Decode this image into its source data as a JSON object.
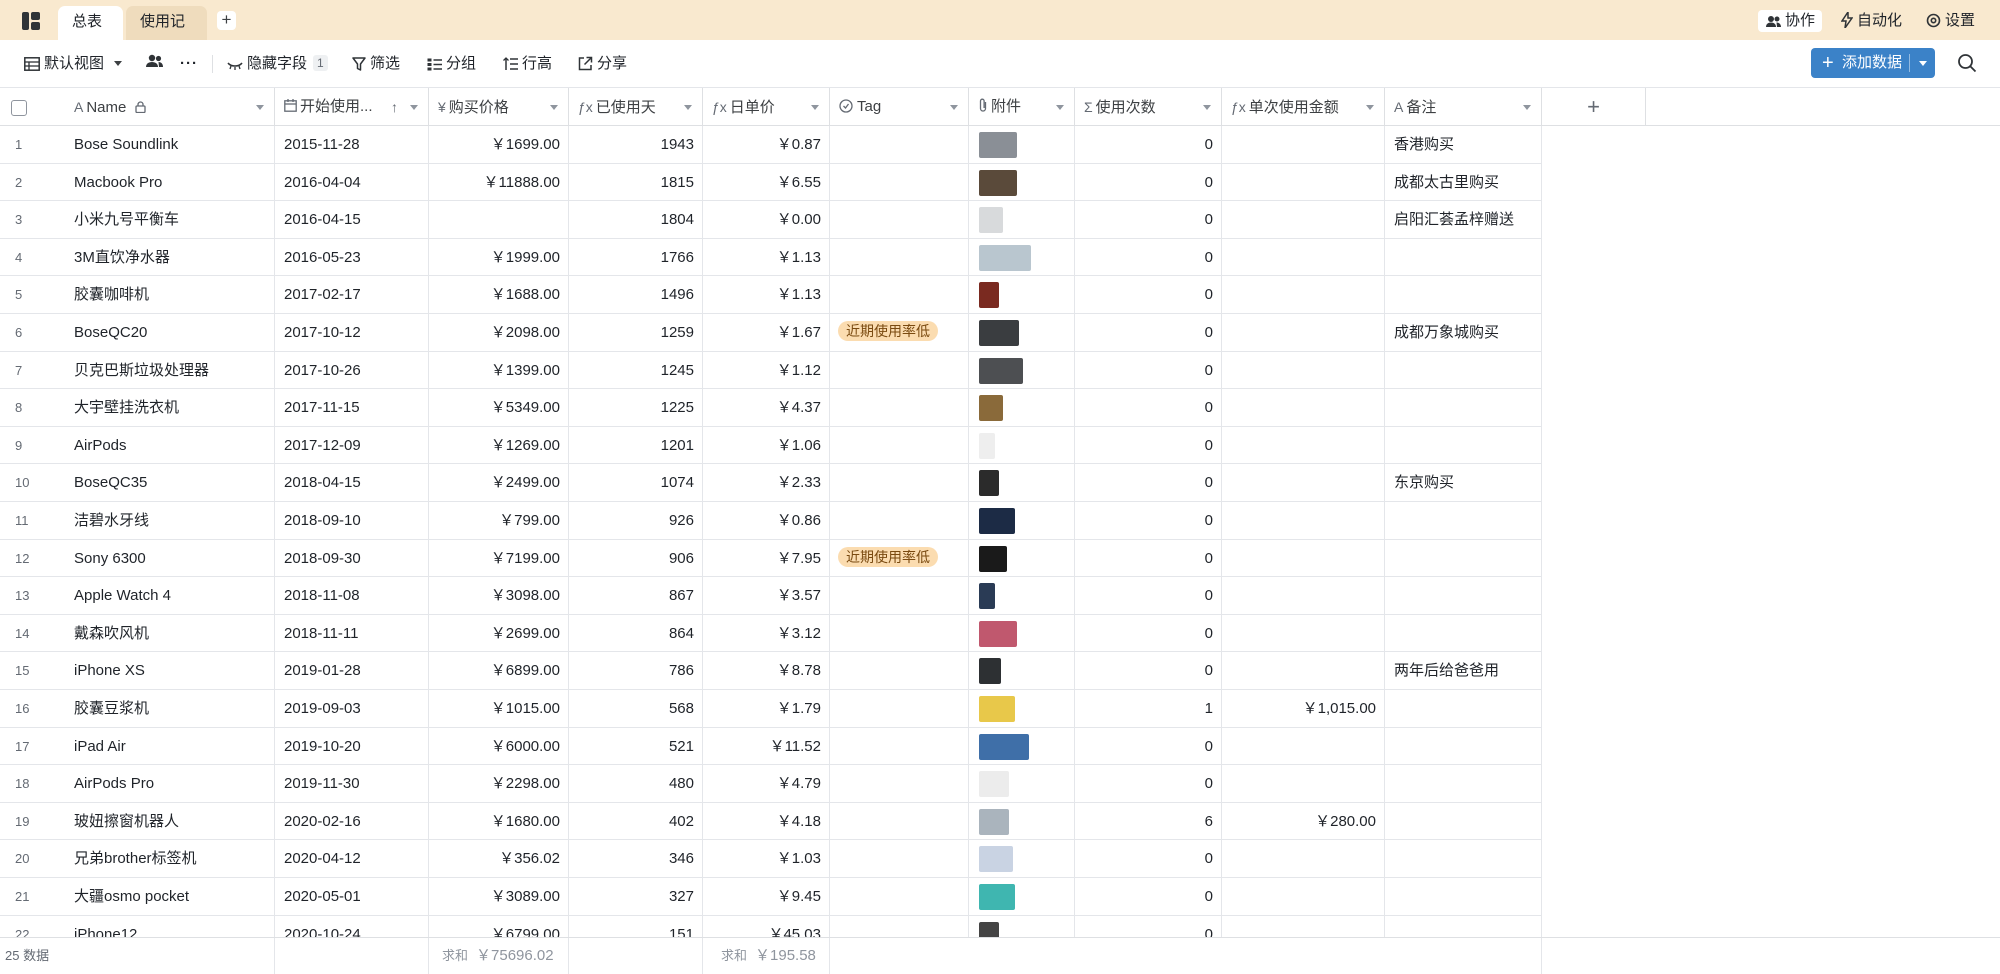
{
  "topbar": {
    "tabs": [
      {
        "label": "总表",
        "active": true
      },
      {
        "label": "使用记录",
        "active": false
      }
    ],
    "add_tab": "+",
    "collab": "协作",
    "automation": "自动化",
    "settings": "设置"
  },
  "toolbar": {
    "view": "默认视图",
    "more": "···",
    "hide_fields": "隐藏字段",
    "hide_fields_count": "1",
    "filter": "筛选",
    "group": "分组",
    "row_height": "行高",
    "share": "分享",
    "add_record": "添加数据"
  },
  "columns": [
    {
      "key": "name",
      "label": "Name",
      "type_icon": "A",
      "lock": true
    },
    {
      "key": "start",
      "label": "开始使用...",
      "type_icon": "date-icon",
      "sort": "↑"
    },
    {
      "key": "price",
      "label": "购买价格",
      "type_icon": "¥"
    },
    {
      "key": "days",
      "label": "已使用天",
      "type_icon": "ƒx"
    },
    {
      "key": "daily",
      "label": "日单价",
      "type_icon": "ƒx"
    },
    {
      "key": "tag",
      "label": "Tag",
      "type_icon": "single-select-icon"
    },
    {
      "key": "attachment",
      "label": "附件",
      "type_icon": "paperclip-icon"
    },
    {
      "key": "uses",
      "label": "使用次数",
      "type_icon": "Σ"
    },
    {
      "key": "per_use",
      "label": "单次使用金额",
      "type_icon": "ƒx"
    },
    {
      "key": "note",
      "label": "备注",
      "type_icon": "A"
    }
  ],
  "add_column": "+",
  "rows": [
    {
      "idx": "1",
      "name": "Bose Soundlink",
      "start": "2015-11-28",
      "price": "￥1699.00",
      "days": "1943",
      "daily": "￥0.87",
      "tag": "",
      "thumb_color": "#8a8f96",
      "uses": "0",
      "per_use": "",
      "note": "香港购买"
    },
    {
      "idx": "2",
      "name": "Macbook Pro",
      "start": "2016-04-04",
      "price": "￥11888.00",
      "days": "1815",
      "daily": "￥6.55",
      "tag": "",
      "thumb_color": "#5a4a3a",
      "uses": "0",
      "per_use": "",
      "note": "成都太古里购买"
    },
    {
      "idx": "3",
      "name": "小米九号平衡车",
      "start": "2016-04-15",
      "price": "",
      "days": "1804",
      "daily": "￥0.00",
      "tag": "",
      "thumb_color": "#d8dadc",
      "uses": "0",
      "per_use": "",
      "note": "启阳汇荟孟梓赠送"
    },
    {
      "idx": "4",
      "name": "3M直饮净水器",
      "start": "2016-05-23",
      "price": "￥1999.00",
      "days": "1766",
      "daily": "￥1.13",
      "tag": "",
      "thumb_color": "#b9c6cf",
      "uses": "0",
      "per_use": "",
      "note": ""
    },
    {
      "idx": "5",
      "name": "胶囊咖啡机",
      "start": "2017-02-17",
      "price": "￥1688.00",
      "days": "1496",
      "daily": "￥1.13",
      "tag": "",
      "thumb_color": "#7a2a20",
      "uses": "0",
      "per_use": "",
      "note": ""
    },
    {
      "idx": "6",
      "name": "BoseQC20",
      "start": "2017-10-12",
      "price": "￥2098.00",
      "days": "1259",
      "daily": "￥1.67",
      "tag": "近期使用率低",
      "thumb_color": "#3a3d40",
      "uses": "0",
      "per_use": "",
      "note": "成都万象城购买"
    },
    {
      "idx": "7",
      "name": "贝克巴斯垃圾处理器",
      "start": "2017-10-26",
      "price": "￥1399.00",
      "days": "1245",
      "daily": "￥1.12",
      "tag": "",
      "thumb_color": "#4d4f52",
      "uses": "0",
      "per_use": "",
      "note": ""
    },
    {
      "idx": "8",
      "name": "大宇壁挂洗衣机",
      "start": "2017-11-15",
      "price": "￥5349.00",
      "days": "1225",
      "daily": "￥4.37",
      "tag": "",
      "thumb_color": "#8a6a3a",
      "uses": "0",
      "per_use": "",
      "note": ""
    },
    {
      "idx": "9",
      "name": "AirPods",
      "start": "2017-12-09",
      "price": "￥1269.00",
      "days": "1201",
      "daily": "￥1.06",
      "tag": "",
      "thumb_color": "#eeeeee",
      "uses": "0",
      "per_use": "",
      "note": ""
    },
    {
      "idx": "10",
      "name": "BoseQC35",
      "start": "2018-04-15",
      "price": "￥2499.00",
      "days": "1074",
      "daily": "￥2.33",
      "tag": "",
      "thumb_color": "#2b2b2b",
      "uses": "0",
      "per_use": "",
      "note": "东京购买"
    },
    {
      "idx": "11",
      "name": "洁碧水牙线",
      "start": "2018-09-10",
      "price": "￥799.00",
      "days": "926",
      "daily": "￥0.86",
      "tag": "",
      "thumb_color": "#1c2b45",
      "uses": "0",
      "per_use": "",
      "note": ""
    },
    {
      "idx": "12",
      "name": "Sony 6300",
      "start": "2018-09-30",
      "price": "￥7199.00",
      "days": "906",
      "daily": "￥7.95",
      "tag": "近期使用率低",
      "thumb_color": "#1a1a1a",
      "uses": "0",
      "per_use": "",
      "note": ""
    },
    {
      "idx": "13",
      "name": "Apple Watch 4",
      "start": "2018-11-08",
      "price": "￥3098.00",
      "days": "867",
      "daily": "￥3.57",
      "tag": "",
      "thumb_color": "#2a3b55",
      "uses": "0",
      "per_use": "",
      "note": ""
    },
    {
      "idx": "14",
      "name": "戴森吹风机",
      "start": "2018-11-11",
      "price": "￥2699.00",
      "days": "864",
      "daily": "￥3.12",
      "tag": "",
      "thumb_color": "#c0586e",
      "uses": "0",
      "per_use": "",
      "note": ""
    },
    {
      "idx": "15",
      "name": "iPhone XS",
      "start": "2019-01-28",
      "price": "￥6899.00",
      "days": "786",
      "daily": "￥8.78",
      "tag": "",
      "thumb_color": "#2d3033",
      "uses": "0",
      "per_use": "",
      "note": "两年后给爸爸用"
    },
    {
      "idx": "16",
      "name": "胶囊豆浆机",
      "start": "2019-09-03",
      "price": "￥1015.00",
      "days": "568",
      "daily": "￥1.79",
      "tag": "",
      "thumb_color": "#e8c84a",
      "uses": "1",
      "per_use": "￥1,015.00",
      "note": ""
    },
    {
      "idx": "17",
      "name": "iPad Air",
      "start": "2019-10-20",
      "price": "￥6000.00",
      "days": "521",
      "daily": "￥11.52",
      "tag": "",
      "thumb_color": "#3f6fa8",
      "uses": "0",
      "per_use": "",
      "note": ""
    },
    {
      "idx": "18",
      "name": "AirPods Pro",
      "start": "2019-11-30",
      "price": "￥2298.00",
      "days": "480",
      "daily": "￥4.79",
      "tag": "",
      "thumb_color": "#ececec",
      "uses": "0",
      "per_use": "",
      "note": ""
    },
    {
      "idx": "19",
      "name": "玻妞擦窗机器人",
      "start": "2020-02-16",
      "price": "￥1680.00",
      "days": "402",
      "daily": "￥4.18",
      "tag": "",
      "thumb_color": "#aab4bd",
      "uses": "6",
      "per_use": "￥280.00",
      "note": ""
    },
    {
      "idx": "20",
      "name": "兄弟brother标签机",
      "start": "2020-04-12",
      "price": "￥356.02",
      "days": "346",
      "daily": "￥1.03",
      "tag": "",
      "thumb_color": "#c9d3e3",
      "uses": "0",
      "per_use": "",
      "note": ""
    },
    {
      "idx": "21",
      "name": "大疆osmo pocket",
      "start": "2020-05-01",
      "price": "￥3089.00",
      "days": "327",
      "daily": "￥9.45",
      "tag": "",
      "thumb_color": "#3fb6b0",
      "uses": "0",
      "per_use": "",
      "note": ""
    },
    {
      "idx": "22",
      "name": "iPhone12",
      "start": "2020-10-24",
      "price": "￥6799.00",
      "days": "151",
      "daily": "￥45.03",
      "tag": "",
      "thumb_color": "#444444",
      "uses": "0",
      "per_use": "",
      "note": ""
    }
  ],
  "footer": {
    "count": "25 数据",
    "sum_label": "求和",
    "price_sum": "￥75696.02",
    "daily_sum": "￥195.58"
  }
}
